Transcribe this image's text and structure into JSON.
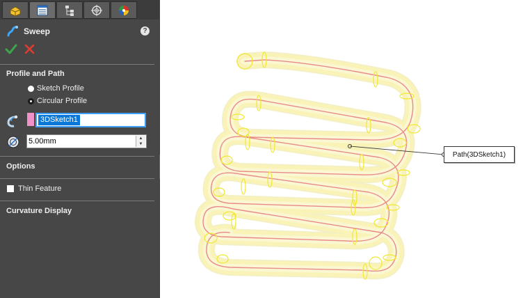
{
  "feature": {
    "title": "Sweep"
  },
  "tabs": [
    {
      "name": "featuremanager-tab",
      "icon": "part-icon"
    },
    {
      "name": "propertymanager-tab",
      "icon": "property-list-icon",
      "active": true
    },
    {
      "name": "configurationmanager-tab",
      "icon": "tree-icon"
    },
    {
      "name": "dimxpert-tab",
      "icon": "crosshair-icon"
    },
    {
      "name": "display-manager-tab",
      "icon": "appearance-icon"
    }
  ],
  "profile_and_path": {
    "heading": "Profile and Path",
    "options": [
      {
        "label": "Sketch Profile",
        "checked": false
      },
      {
        "label": "Circular Profile",
        "checked": true
      }
    ],
    "path_selection": "3DSketch1",
    "diameter": "5.00mm"
  },
  "options_section": {
    "heading": "Options"
  },
  "thin_feature": {
    "label": "Thin Feature",
    "checked": false
  },
  "curvature": {
    "heading": "Curvature Display"
  },
  "callout": {
    "label": "Path(3DSketch1)"
  },
  "colors": {
    "panel_bg": "#474747",
    "accent_blue": "#0a78d7",
    "path_swatch": "#f091c8",
    "sweep_fill": "#f9f3b8",
    "sweep_edge": "#f0e830",
    "path_line": "#e98a8a",
    "ok_green": "#3ca64a",
    "cancel_red": "#e03c31"
  }
}
